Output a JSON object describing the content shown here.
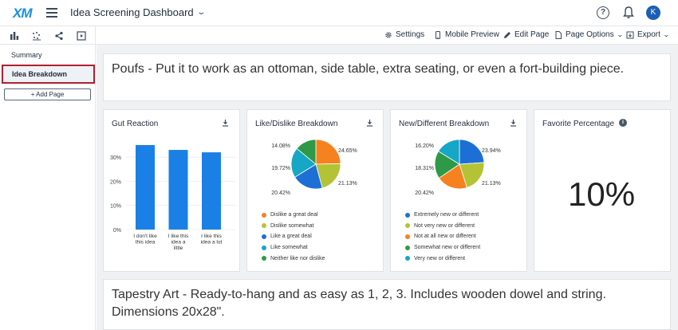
{
  "app": {
    "logo": "XM",
    "title": "Idea Screening Dashboard",
    "avatar_initial": "K"
  },
  "toolbar": {
    "settings": "Settings",
    "mobile_preview": "Mobile Preview",
    "edit_page": "Edit Page",
    "page_options": "Page Options",
    "export": "Export"
  },
  "sidebar": {
    "items": [
      {
        "label": "Summary"
      },
      {
        "label": "Idea Breakdown"
      }
    ],
    "add_page": "Add Page"
  },
  "ideas": {
    "first": "Poufs - Put it to work as an ottoman, side table, extra seating, or even a fort-building piece.",
    "second": "Tapestry Art - Ready-to-hang and as easy as 1, 2, 3. Includes wooden dowel and string. Dimensions 20x28\"."
  },
  "widgets": {
    "gut": {
      "title": "Gut Reaction"
    },
    "like": {
      "title": "Like/Dislike Breakdown"
    },
    "newdiff": {
      "title": "New/Different Breakdown"
    },
    "fav": {
      "title": "Favorite Percentage",
      "value": "10%"
    }
  },
  "chart_data": [
    {
      "type": "bar",
      "title": "Gut Reaction",
      "categories": [
        "I don't like this idea",
        "I like this idea a little",
        "I like this idea a lot"
      ],
      "category_lines": [
        [
          "I don't like",
          "this idea"
        ],
        [
          "I like this",
          "idea a",
          "little"
        ],
        [
          "I like this",
          "idea a lot"
        ]
      ],
      "values": [
        35,
        33,
        32
      ],
      "yticks": [
        "0%",
        "10%",
        "20%",
        "30%"
      ],
      "ylim": [
        0,
        35
      ],
      "color": "#1a80e5"
    },
    {
      "type": "pie",
      "title": "Like/Dislike Breakdown",
      "slices": [
        {
          "name": "Dislike a great deal",
          "value": 24.65,
          "label": "24.65%",
          "color": "#f5821f"
        },
        {
          "name": "Dislike somewhat",
          "value": 21.13,
          "label": "21.13%",
          "color": "#b3c335"
        },
        {
          "name": "Like a great deal",
          "value": 20.42,
          "label": "20.42%",
          "color": "#1d6fd6"
        },
        {
          "name": "Like somewhat",
          "value": 19.72,
          "label": "19.72%",
          "color": "#16a6c6"
        },
        {
          "name": "Neither like nor dislike",
          "value": 14.08,
          "label": "14.08%",
          "color": "#2e9a47"
        }
      ]
    },
    {
      "type": "pie",
      "title": "New/Different Breakdown",
      "slices": [
        {
          "name": "Extremely new or different",
          "value": 23.94,
          "label": "23.94%",
          "color": "#1d6fd6"
        },
        {
          "name": "Not very new or different",
          "value": 21.13,
          "label": "21.13%",
          "color": "#b3c335"
        },
        {
          "name": "Not at all new or different",
          "value": 20.42,
          "label": "20.42%",
          "color": "#f5821f"
        },
        {
          "name": "Somewhat new or different",
          "value": 18.31,
          "label": "18.31%",
          "color": "#2e9a47"
        },
        {
          "name": "Very new or different",
          "value": 16.2,
          "label": "16.20%",
          "color": "#16a6c6"
        }
      ]
    }
  ]
}
